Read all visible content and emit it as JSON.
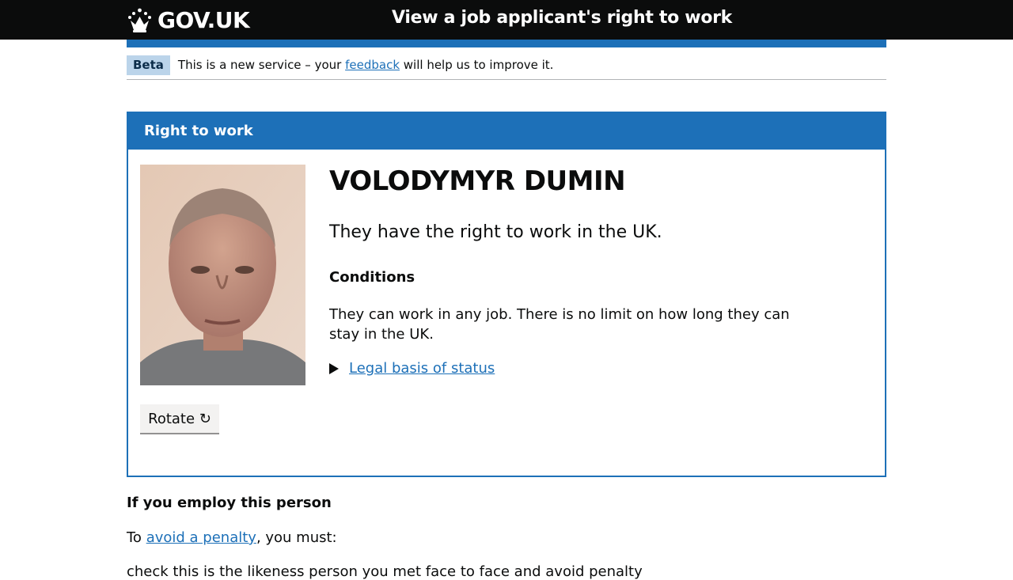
{
  "header": {
    "logo_text": "GOV.UK",
    "service_name": "View a job applicant's right to work"
  },
  "phase_banner": {
    "tag": "Beta",
    "text_before": "This is a new service – your",
    "link": "feedback",
    "text_after": "will help us to improve it."
  },
  "card": {
    "title": "Right to work",
    "name": "VOLODYMYR DUMIN",
    "status": "They have the right to work in the UK.",
    "conditions_heading": "Conditions",
    "conditions_text": "They can work in any job. There is no limit on how long they can stay in the UK.",
    "legal_basis_link": "Legal basis of status",
    "rotate_button": "Rotate ↻"
  },
  "employment": {
    "heading": "If you employ this person",
    "para_before": "To",
    "para_link": "avoid a penalty",
    "para_after": ", you must:",
    "cut_text": "check this is the likeness person you met face to face and avoid penalty"
  },
  "colors": {
    "header_bg": "#0b0c0c",
    "brand_blue": "#1d70b8",
    "tag_bg": "#bbd4ea",
    "button_bg": "#f3f2f1"
  }
}
